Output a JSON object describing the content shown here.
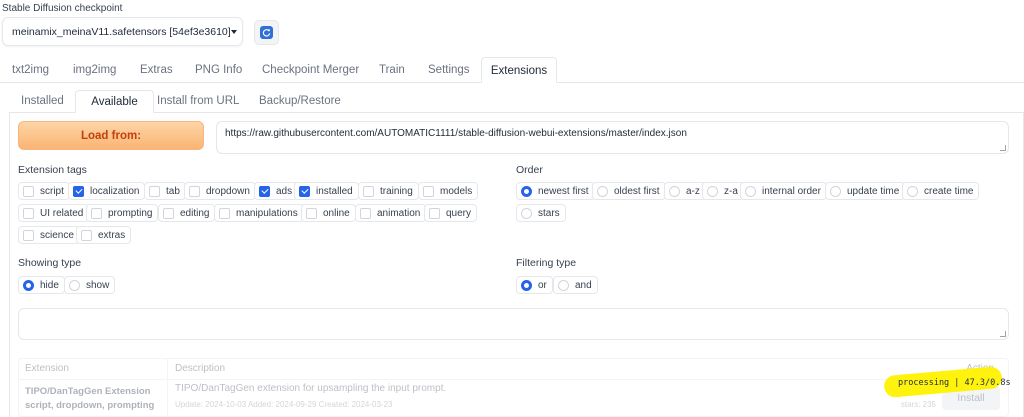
{
  "checkpoint": {
    "label": "Stable Diffusion checkpoint",
    "value": "meinamix_meinaV11.safetensors [54ef3e3610]",
    "refresh_icon": "refresh-icon"
  },
  "main_tabs": [
    {
      "label": "txt2img"
    },
    {
      "label": "img2img"
    },
    {
      "label": "Extras"
    },
    {
      "label": "PNG Info"
    },
    {
      "label": "Checkpoint Merger"
    },
    {
      "label": "Train"
    },
    {
      "label": "Settings"
    },
    {
      "label": "Extensions",
      "active": true
    }
  ],
  "sub_tabs": [
    {
      "label": "Installed"
    },
    {
      "label": "Available",
      "active": true
    },
    {
      "label": "Install from URL"
    },
    {
      "label": "Backup/Restore"
    }
  ],
  "load_from": {
    "button_label": "Load from:",
    "url": "https://raw.githubusercontent.com/AUTOMATIC1111/stable-diffusion-webui-extensions/master/index.json"
  },
  "extension_tags": {
    "label": "Extension tags",
    "items": [
      {
        "label": "script",
        "checked": false
      },
      {
        "label": "localization",
        "checked": true
      },
      {
        "label": "tab",
        "checked": false
      },
      {
        "label": "dropdown",
        "checked": false
      },
      {
        "label": "ads",
        "checked": true
      },
      {
        "label": "installed",
        "checked": true
      },
      {
        "label": "training",
        "checked": false
      },
      {
        "label": "models",
        "checked": false
      },
      {
        "label": "UI related",
        "checked": false
      },
      {
        "label": "prompting",
        "checked": false
      },
      {
        "label": "editing",
        "checked": false
      },
      {
        "label": "manipulations",
        "checked": false
      },
      {
        "label": "online",
        "checked": false
      },
      {
        "label": "animation",
        "checked": false
      },
      {
        "label": "query",
        "checked": false
      },
      {
        "label": "science",
        "checked": false
      },
      {
        "label": "extras",
        "checked": false
      }
    ]
  },
  "order": {
    "label": "Order",
    "items": [
      {
        "label": "newest first",
        "checked": true
      },
      {
        "label": "oldest first",
        "checked": false
      },
      {
        "label": "a-z",
        "checked": false
      },
      {
        "label": "z-a",
        "checked": false
      },
      {
        "label": "internal order",
        "checked": false
      },
      {
        "label": "update time",
        "checked": false
      },
      {
        "label": "create time",
        "checked": false
      },
      {
        "label": "stars",
        "checked": false
      }
    ]
  },
  "showing_type": {
    "label": "Showing type",
    "items": [
      {
        "label": "hide",
        "checked": true
      },
      {
        "label": "show",
        "checked": false
      }
    ]
  },
  "filtering_type": {
    "label": "Filtering type",
    "items": [
      {
        "label": "or",
        "checked": true
      },
      {
        "label": "and",
        "checked": false
      }
    ]
  },
  "search": {
    "value": ""
  },
  "table": {
    "headers": {
      "extension": "Extension",
      "description": "Description",
      "action": "Action"
    },
    "rows": [
      {
        "name": "TIPO/DanTagGen Extension",
        "tags": "script, dropdown, prompting",
        "description": "TIPO/DanTagGen extension for upsampling the input prompt.",
        "dates": "Update: 2024-10-03 Added: 2024-09-29 Created: 2024-03-23",
        "stars": "stars: 235",
        "action": "Install"
      }
    ]
  },
  "processing_text": "processing | 47.3/0.8s",
  "colors": {
    "accent": "#2563eb",
    "load_button": "#fab472",
    "highlight": "#fff200"
  }
}
